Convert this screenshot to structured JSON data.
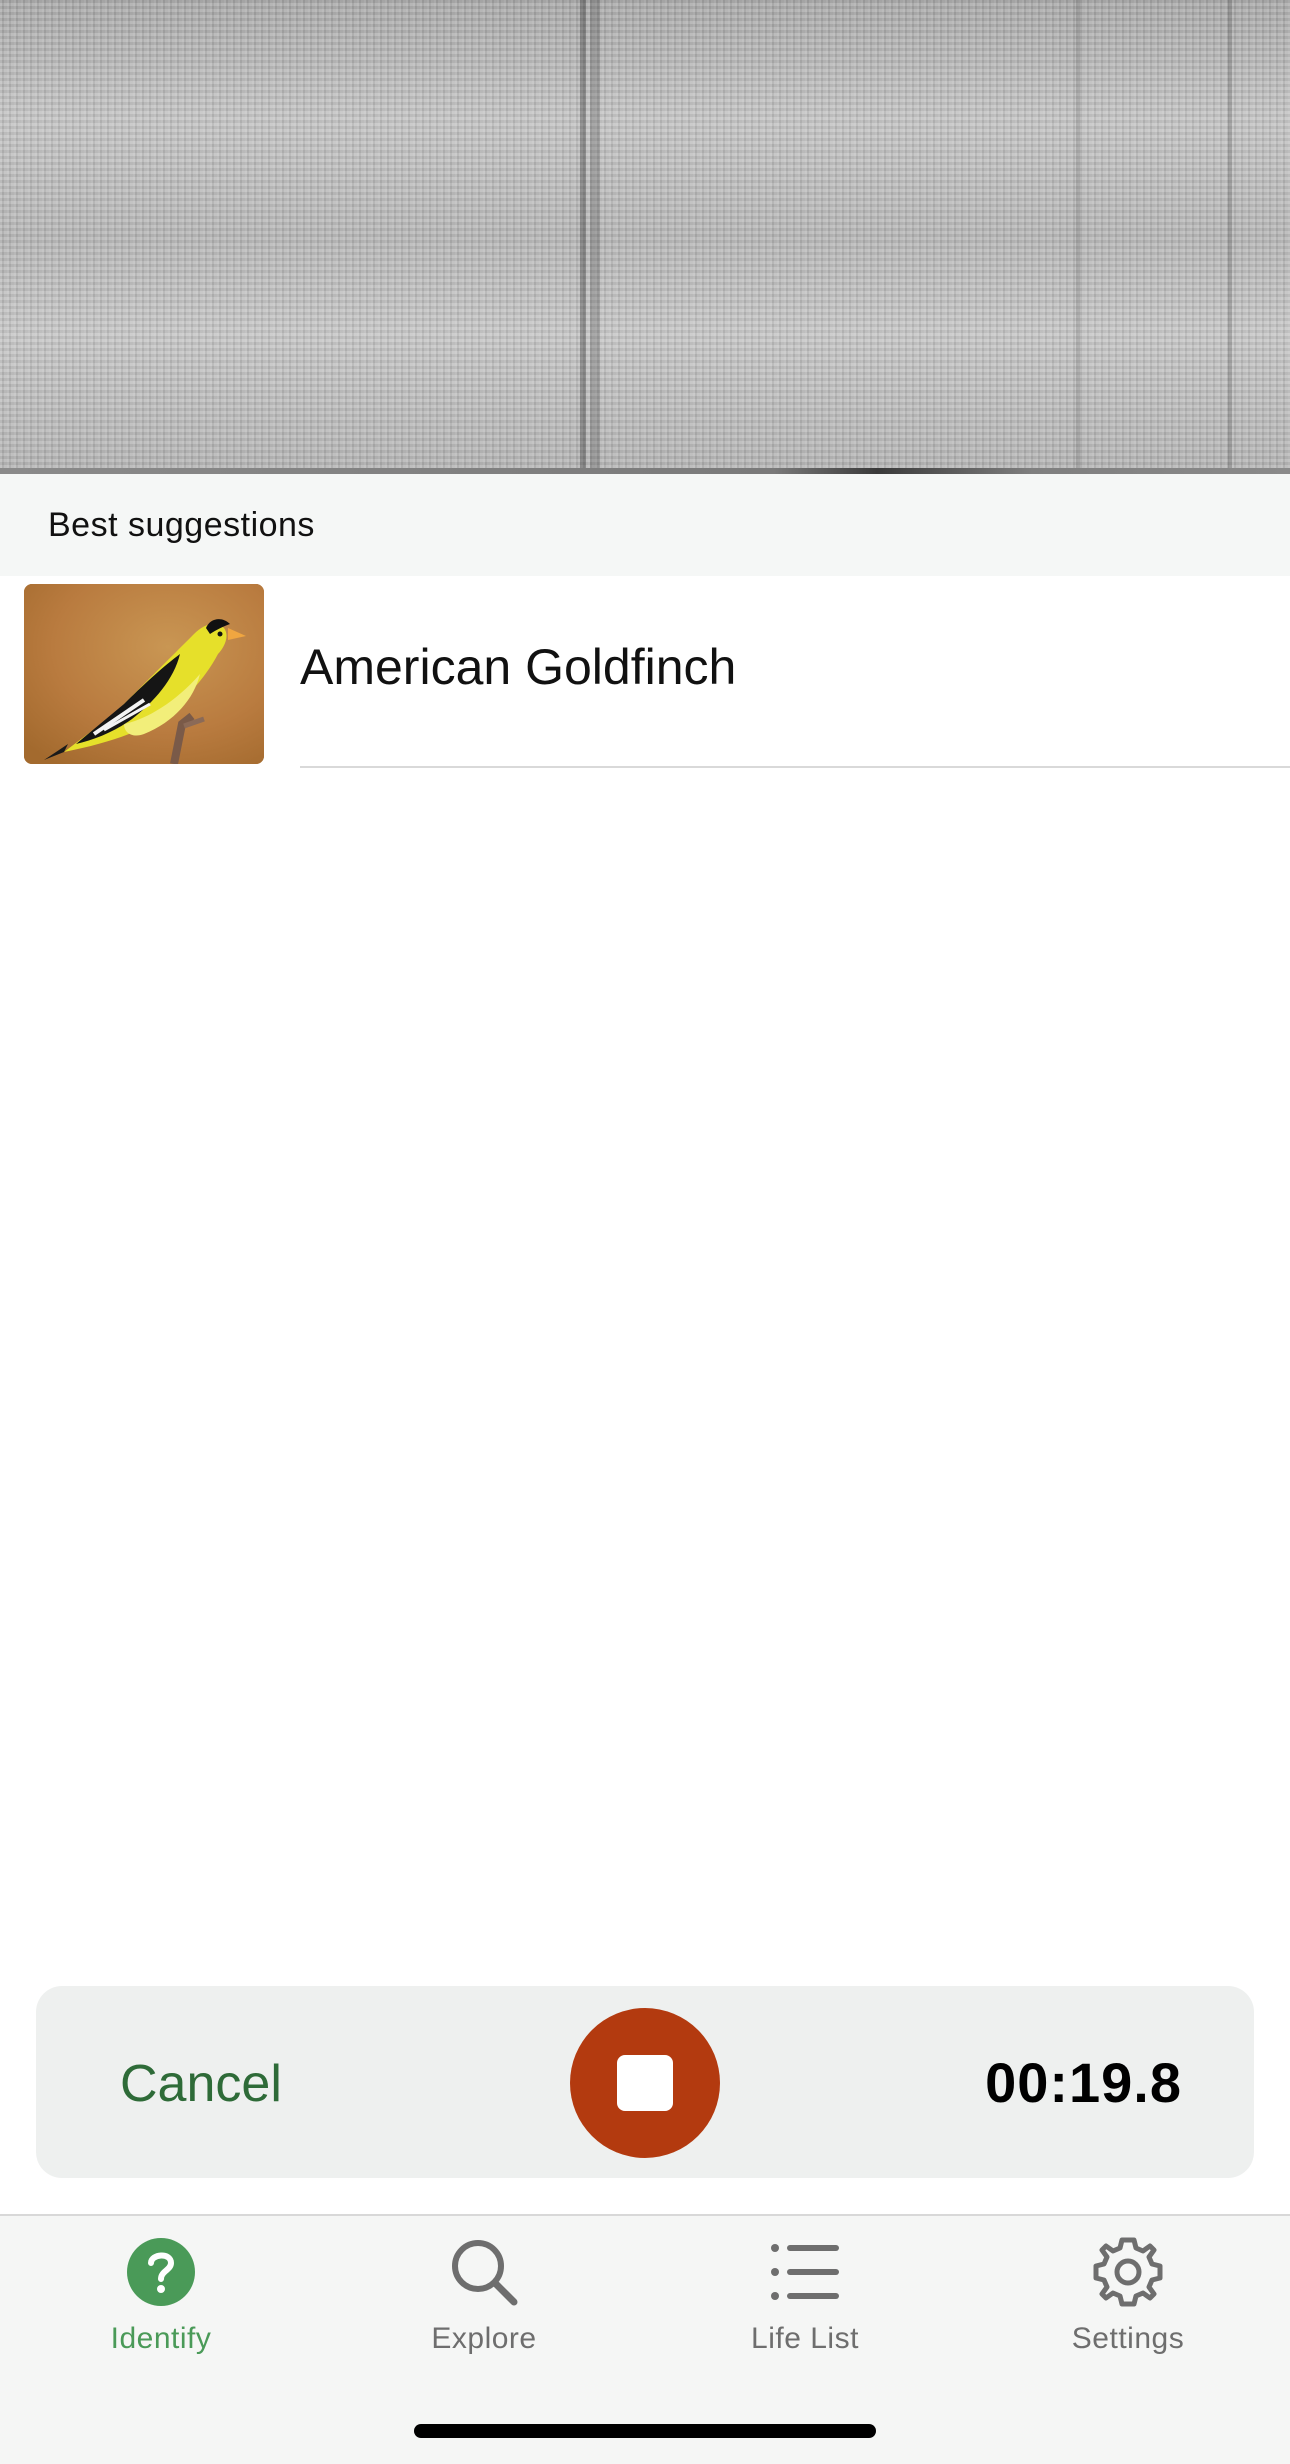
{
  "spectrogram": {
    "icon": "spectrogram-image"
  },
  "suggestions": {
    "title": "Best suggestions",
    "items": [
      {
        "name": "American Goldfinch",
        "image": "american-goldfinch-photo"
      }
    ]
  },
  "recorder": {
    "cancel_label": "Cancel",
    "timer": "00:19.8",
    "stop_color": "#b33a0f"
  },
  "tabs": [
    {
      "label": "Identify",
      "icon": "question-circle-icon",
      "active": true
    },
    {
      "label": "Explore",
      "icon": "search-icon",
      "active": false
    },
    {
      "label": "Life List",
      "icon": "list-icon",
      "active": false
    },
    {
      "label": "Settings",
      "icon": "gear-icon",
      "active": false
    }
  ],
  "colors": {
    "accent": "#4a9a58",
    "cancel": "#2e6b38"
  }
}
